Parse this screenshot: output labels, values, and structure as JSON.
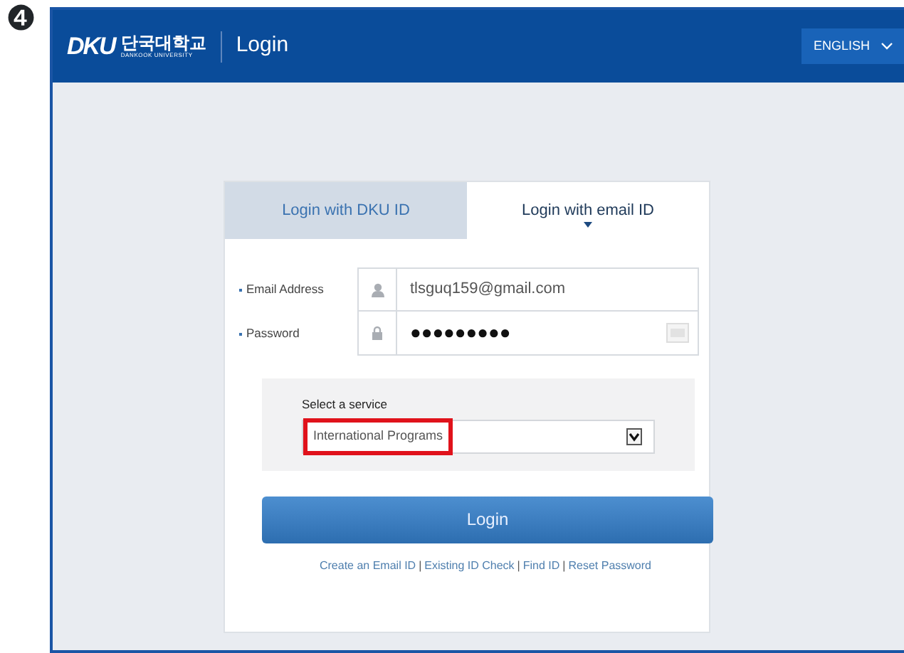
{
  "step_marker": "❹",
  "header": {
    "logo_mark": "DKU",
    "logo_korean": "단국대학교",
    "logo_english": "DANKOOK UNIVERSITY",
    "title": "Login",
    "language": "ENGLISH"
  },
  "tabs": [
    {
      "label": "Login with DKU ID",
      "selected": false
    },
    {
      "label": "Login with email ID",
      "selected": true
    }
  ],
  "fields": [
    {
      "label": "Email Address",
      "kind": "user",
      "value": "tlsguq159@gmail.com",
      "keyboard": false
    },
    {
      "label": "Password",
      "kind": "lock",
      "value": "●●●●●●●●●",
      "keyboard": true
    }
  ],
  "service": {
    "label": "Select a service",
    "value": "International Programs",
    "highlighted": true
  },
  "login_button": "Login",
  "separator": "|",
  "links": [
    "Create an Email ID",
    "Existing ID Check",
    "Find ID",
    "Reset Password"
  ]
}
